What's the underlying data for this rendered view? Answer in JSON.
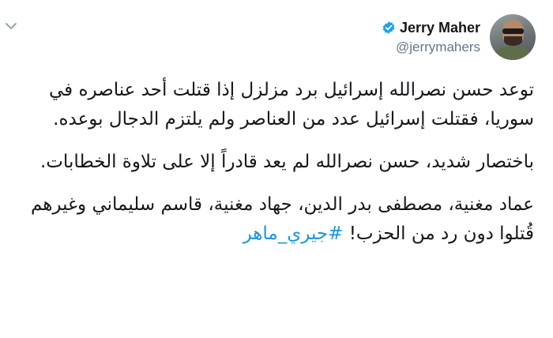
{
  "author": {
    "display_name": "Jerry Maher",
    "handle": "@jerrymahers"
  },
  "tweet": {
    "paragraph_1": "توعد حسن نصرالله إسرائيل برد مزلزل إذا قتلت أحد عناصره في سوريا، فقتلت إسرائيل عدد من العناصر ولم يلتزم الدجال بوعده.",
    "paragraph_2": "باختصار شديد، حسن نصرالله لم يعد قادراً إلا على تلاوة الخطابات.",
    "paragraph_3": "عماد مغنية، مصطفى بدر الدين، جهاد مغنية، قاسم سليماني وغيرهم قُتلوا دون رد من الحزب! ",
    "hashtag": "#جيري_ماهر"
  },
  "colors": {
    "verified": "#1da1f2",
    "hashtag": "#1b95e0",
    "handle": "#657786"
  },
  "icons": {
    "menu": "chevron-down-icon",
    "verified": "verified-badge-icon"
  }
}
